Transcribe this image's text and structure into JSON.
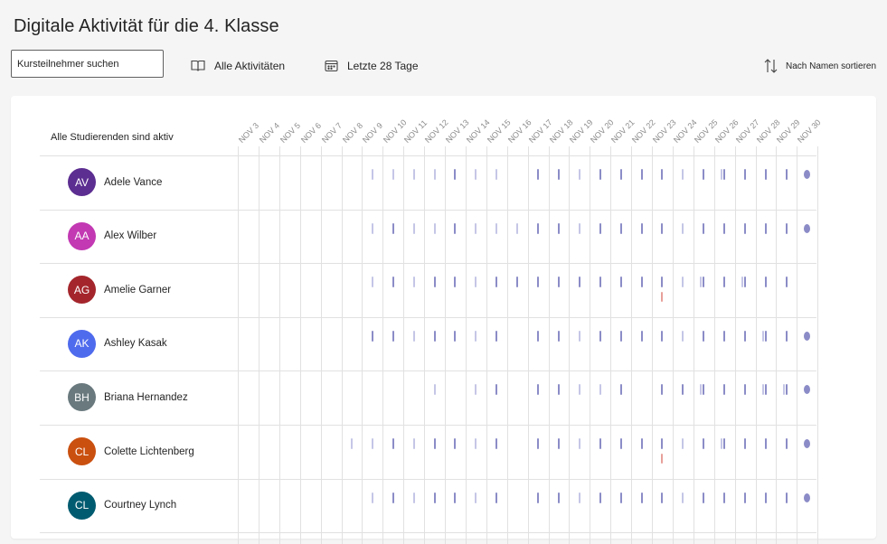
{
  "page": {
    "title": "Digitale Aktivität für die 4. Klasse"
  },
  "toolbar": {
    "search_placeholder": "Kursteilnehmer suchen",
    "activities_label": "Alle Aktivitäten",
    "activities_icon": "book-icon",
    "range_label": "Letzte 28 Tage",
    "range_icon": "calendar-icon",
    "sort_label": "Nach Namen sortieren",
    "sort_icon": "sort-icon"
  },
  "table": {
    "header_label": "Alle Studierenden sind aktiv",
    "dates": [
      "NOV 3",
      "NOV 4",
      "NOV 5",
      "NOV 6",
      "NOV 7",
      "NOV 8",
      "NOV 9",
      "NOV 10",
      "NOV 11",
      "NOV 12",
      "NOV 13",
      "NOV 14",
      "NOV 15",
      "NOV 16",
      "NOV 17",
      "NOV 18",
      "NOV 19",
      "NOV 20",
      "NOV 21",
      "NOV 22",
      "NOV 23",
      "NOV 24",
      "NOV 25",
      "NOV 26",
      "NOV 27",
      "NOV 28",
      "NOV 29",
      "NOV 30"
    ],
    "colors": {
      "activity": "#8b8cc7",
      "activity_light": "#c5c6e6",
      "alert": "#e8a09a"
    },
    "students": [
      {
        "initials": "AV",
        "name": "Adele Vance",
        "color": "#5c2e91",
        "activity": {
          "NOV 9": 1,
          "NOV 10": 1,
          "NOV 11": 1,
          "NOV 12": 1,
          "NOV 13": 2,
          "NOV 14": 1,
          "NOV 15": 1,
          "NOV 17": 2,
          "NOV 18": 2,
          "NOV 19": 1,
          "NOV 20": 2,
          "NOV 21": 2,
          "NOV 22": 2,
          "NOV 23": 2,
          "NOV 24": 1,
          "NOV 25": 2,
          "NOV 26": 3,
          "NOV 27": 2,
          "NOV 28": 2,
          "NOV 29": 2,
          "NOV 30": 4
        }
      },
      {
        "initials": "AA",
        "name": "Alex Wilber",
        "color": "#c239b3",
        "activity": {
          "NOV 9": 1,
          "NOV 10": 2,
          "NOV 11": 1,
          "NOV 12": 1,
          "NOV 13": 2,
          "NOV 14": 1,
          "NOV 15": 1,
          "NOV 16": 1,
          "NOV 17": 2,
          "NOV 18": 2,
          "NOV 19": 1,
          "NOV 20": 2,
          "NOV 21": 2,
          "NOV 22": 2,
          "NOV 23": 2,
          "NOV 24": 1,
          "NOV 25": 2,
          "NOV 26": 2,
          "NOV 27": 2,
          "NOV 28": 2,
          "NOV 29": 2,
          "NOV 30": 4
        }
      },
      {
        "initials": "AG",
        "name": "Amelie Garner",
        "color": "#a4262c",
        "activity": {
          "NOV 9": 1,
          "NOV 10": 2,
          "NOV 11": 1,
          "NOV 12": 2,
          "NOV 13": 2,
          "NOV 14": 1,
          "NOV 15": 2,
          "NOV 16": 2,
          "NOV 17": 2,
          "NOV 18": 2,
          "NOV 19": 2,
          "NOV 20": 2,
          "NOV 21": 2,
          "NOV 22": 2,
          "NOV 23": 2,
          "NOV 24": 1,
          "NOV 25": 3,
          "NOV 26": 2,
          "NOV 27": 3,
          "NOV 28": 2,
          "NOV 29": 2
        },
        "alerts": {
          "NOV 23": 1
        }
      },
      {
        "initials": "AK",
        "name": "Ashley Kasak",
        "color": "#4f6bed",
        "activity": {
          "NOV 9": 2,
          "NOV 10": 2,
          "NOV 11": 1,
          "NOV 12": 2,
          "NOV 13": 2,
          "NOV 14": 1,
          "NOV 15": 2,
          "NOV 17": 2,
          "NOV 18": 2,
          "NOV 19": 1,
          "NOV 20": 2,
          "NOV 21": 2,
          "NOV 22": 2,
          "NOV 23": 2,
          "NOV 24": 1,
          "NOV 25": 2,
          "NOV 26": 2,
          "NOV 27": 2,
          "NOV 28": 3,
          "NOV 29": 2,
          "NOV 30": 4
        }
      },
      {
        "initials": "BH",
        "name": "Briana Hernandez",
        "color": "#69797e",
        "activity": {
          "NOV 12": 1,
          "NOV 14": 1,
          "NOV 15": 2,
          "NOV 17": 2,
          "NOV 18": 2,
          "NOV 19": 1,
          "NOV 20": 1,
          "NOV 21": 2,
          "NOV 23": 2,
          "NOV 24": 2,
          "NOV 25": 3,
          "NOV 26": 2,
          "NOV 27": 2,
          "NOV 28": 3,
          "NOV 29": 3,
          "NOV 30": 4
        }
      },
      {
        "initials": "CL",
        "name": "Colette Lichtenberg",
        "color": "#ca5010",
        "activity": {
          "NOV 8": 1,
          "NOV 9": 1,
          "NOV 10": 2,
          "NOV 11": 1,
          "NOV 12": 2,
          "NOV 13": 2,
          "NOV 14": 1,
          "NOV 15": 2,
          "NOV 17": 2,
          "NOV 18": 2,
          "NOV 19": 1,
          "NOV 20": 2,
          "NOV 21": 2,
          "NOV 22": 2,
          "NOV 23": 2,
          "NOV 24": 1,
          "NOV 25": 2,
          "NOV 26": 3,
          "NOV 27": 2,
          "NOV 28": 2,
          "NOV 29": 2,
          "NOV 30": 4
        },
        "alerts": {
          "NOV 23": 1
        }
      },
      {
        "initials": "CL",
        "name": "Courtney Lynch",
        "color": "#005b70",
        "activity": {
          "NOV 9": 1,
          "NOV 10": 2,
          "NOV 11": 1,
          "NOV 12": 2,
          "NOV 13": 2,
          "NOV 14": 1,
          "NOV 15": 2,
          "NOV 17": 2,
          "NOV 18": 2,
          "NOV 19": 1,
          "NOV 20": 2,
          "NOV 21": 2,
          "NOV 22": 2,
          "NOV 23": 2,
          "NOV 24": 1,
          "NOV 25": 2,
          "NOV 26": 2,
          "NOV 27": 2,
          "NOV 28": 2,
          "NOV 29": 2,
          "NOV 30": 4
        }
      }
    ]
  }
}
